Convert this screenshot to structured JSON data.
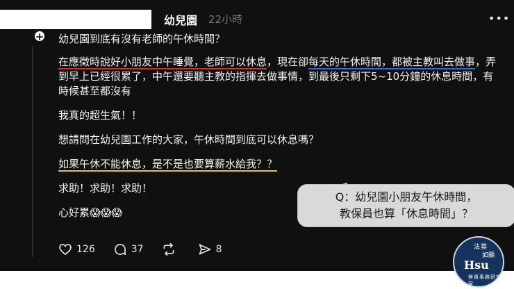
{
  "post": {
    "username": "幼兒園",
    "timestamp": "22小時",
    "menu_icon": "more-dots-icon",
    "title": "幼兒園到底有沒有老師的午休時間？",
    "para1_red": "在應徵時說好小朋友中午睡覺，老師可以休息",
    "para1_mid": "，現在卻",
    "para1_blue1": "每天的午休時間，都被主教",
    "para1_blue2": "叫去做事",
    "para1_rest": "，弄到早上已經很累了，中午還要聽主教的指揮去做事情，到最後只剩下5~10分鐘的休息時間，有時候甚至都沒有",
    "angry": "我真的超生氣！！",
    "question": "想請問在幼兒園工作的大家，午休時間到底可以休息嗎？",
    "yellow_line": "如果午休不能休息，是不是也要算薪水給我？？",
    "help": "求助！求助！求助！",
    "tired": "心好累😱😱😱",
    "actions": {
      "likes": "126",
      "comments": "37",
      "reposts": "",
      "shares": "8"
    }
  },
  "callout": {
    "line1": "Q：幼兒園小朋友午休時間，",
    "line2": "教保員也算「休息時間」？"
  },
  "seal": {
    "text": "法莫如顯 Hsu 勞資事務研究室"
  }
}
